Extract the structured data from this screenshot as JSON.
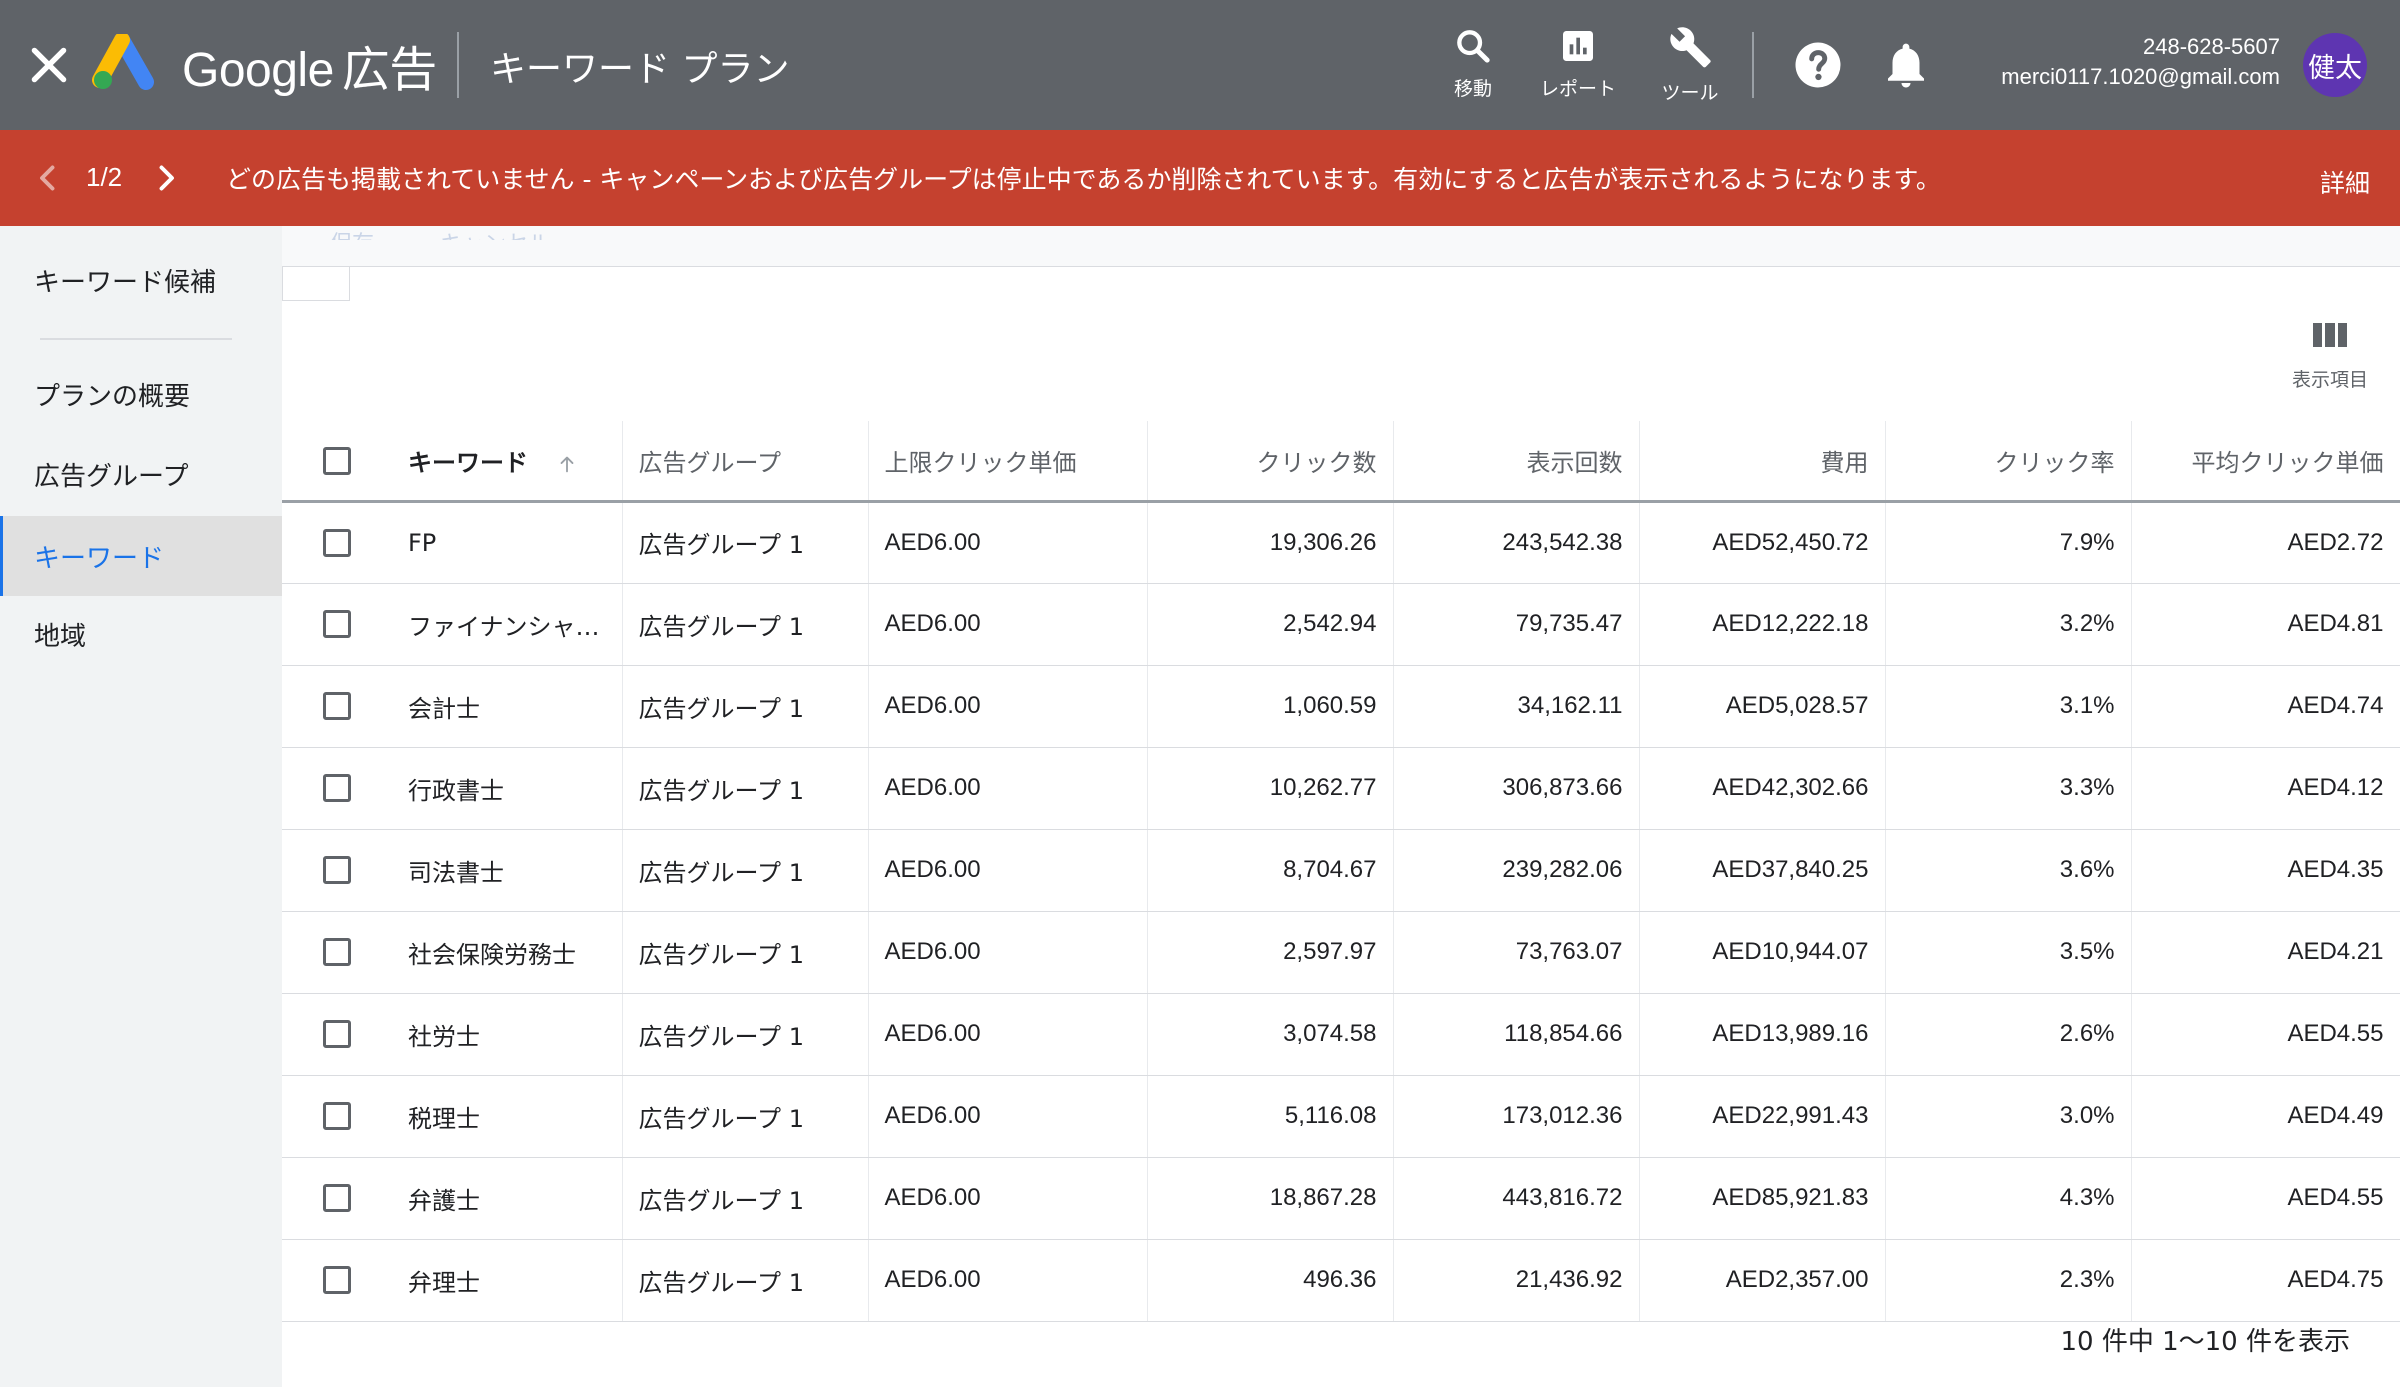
{
  "header": {
    "brand_google": "Google",
    "brand_ads": "広告",
    "app_title": "キーワード プラン",
    "tools": [
      {
        "label": "移動",
        "icon": "search-icon"
      },
      {
        "label": "レポート",
        "icon": "reports-icon"
      },
      {
        "label": "ツール",
        "icon": "wrench-icon"
      }
    ],
    "phone": "248-628-5607",
    "email": "merci0117.1020@gmail.com",
    "avatar_text": "健太"
  },
  "alert": {
    "pager": "1/2",
    "message": "どの広告も掲載されていません - キャンペーンおよび広告グループは停止中であるか削除されています。有効にすると広告が表示されるようになります。",
    "details": "詳細",
    "color": "#c5412f"
  },
  "sidebar": {
    "items": [
      {
        "label": "キーワード候補",
        "active": false
      },
      {
        "label": "プランの概要",
        "active": false
      },
      {
        "label": "広告グループ",
        "active": false
      },
      {
        "label": "キーワード",
        "active": true
      },
      {
        "label": "地域",
        "active": false
      }
    ]
  },
  "toolbar": {
    "columns_label": "表示項目",
    "faded_text": "保存　　　キャンセル"
  },
  "table": {
    "headers": {
      "keyword": "キーワード",
      "ad_group": "広告グループ",
      "max_cpc": "上限クリック単価",
      "clicks": "クリック数",
      "impressions": "表示回数",
      "cost": "費用",
      "ctr": "クリック率",
      "avg_cpc": "平均クリック単価"
    },
    "rows": [
      {
        "keyword": "FP",
        "ad_group": "広告グループ 1",
        "max_cpc": "AED6.00",
        "clicks": "19,306.26",
        "impressions": "243,542.38",
        "cost": "AED52,450.72",
        "ctr": "7.9%",
        "avg_cpc": "AED2.72"
      },
      {
        "keyword": "ファイナンシャル…",
        "ad_group": "広告グループ 1",
        "max_cpc": "AED6.00",
        "clicks": "2,542.94",
        "impressions": "79,735.47",
        "cost": "AED12,222.18",
        "ctr": "3.2%",
        "avg_cpc": "AED4.81"
      },
      {
        "keyword": "会計士",
        "ad_group": "広告グループ 1",
        "max_cpc": "AED6.00",
        "clicks": "1,060.59",
        "impressions": "34,162.11",
        "cost": "AED5,028.57",
        "ctr": "3.1%",
        "avg_cpc": "AED4.74"
      },
      {
        "keyword": "行政書士",
        "ad_group": "広告グループ 1",
        "max_cpc": "AED6.00",
        "clicks": "10,262.77",
        "impressions": "306,873.66",
        "cost": "AED42,302.66",
        "ctr": "3.3%",
        "avg_cpc": "AED4.12"
      },
      {
        "keyword": "司法書士",
        "ad_group": "広告グループ 1",
        "max_cpc": "AED6.00",
        "clicks": "8,704.67",
        "impressions": "239,282.06",
        "cost": "AED37,840.25",
        "ctr": "3.6%",
        "avg_cpc": "AED4.35"
      },
      {
        "keyword": "社会保険労務士",
        "ad_group": "広告グループ 1",
        "max_cpc": "AED6.00",
        "clicks": "2,597.97",
        "impressions": "73,763.07",
        "cost": "AED10,944.07",
        "ctr": "3.5%",
        "avg_cpc": "AED4.21"
      },
      {
        "keyword": "社労士",
        "ad_group": "広告グループ 1",
        "max_cpc": "AED6.00",
        "clicks": "3,074.58",
        "impressions": "118,854.66",
        "cost": "AED13,989.16",
        "ctr": "2.6%",
        "avg_cpc": "AED4.55"
      },
      {
        "keyword": "税理士",
        "ad_group": "広告グループ 1",
        "max_cpc": "AED6.00",
        "clicks": "5,116.08",
        "impressions": "173,012.36",
        "cost": "AED22,991.43",
        "ctr": "3.0%",
        "avg_cpc": "AED4.49"
      },
      {
        "keyword": "弁護士",
        "ad_group": "広告グループ 1",
        "max_cpc": "AED6.00",
        "clicks": "18,867.28",
        "impressions": "443,816.72",
        "cost": "AED85,921.83",
        "ctr": "4.3%",
        "avg_cpc": "AED4.55"
      },
      {
        "keyword": "弁理士",
        "ad_group": "広告グループ 1",
        "max_cpc": "AED6.00",
        "clicks": "496.36",
        "impressions": "21,436.92",
        "cost": "AED2,357.00",
        "ctr": "2.3%",
        "avg_cpc": "AED4.75"
      }
    ],
    "footer": "10 件中 1〜10 件を表示"
  }
}
